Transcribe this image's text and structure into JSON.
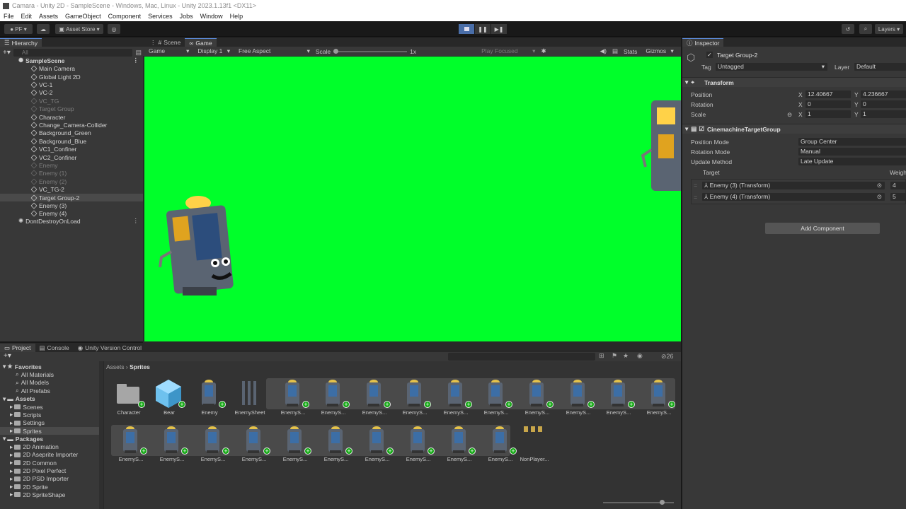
{
  "window": {
    "title": "Camara - Unity 2D - SampleScene - Windows, Mac, Linux - Unity 2023.1.13f1 <DX11>"
  },
  "menu": [
    "File",
    "Edit",
    "Assets",
    "GameObject",
    "Component",
    "Services",
    "Jobs",
    "Window",
    "Help"
  ],
  "toolbar": {
    "account": "PF",
    "asset_store": "Asset Store",
    "layers": "Layers"
  },
  "hierarchy": {
    "tab": "Hierarchy",
    "search_placeholder": "All",
    "scene": "SampleScene",
    "items": [
      {
        "label": "Main Camera",
        "dim": false,
        "sel": false
      },
      {
        "label": "Global Light 2D",
        "dim": false,
        "sel": false
      },
      {
        "label": "VC-1",
        "dim": false,
        "sel": false
      },
      {
        "label": "VC-2",
        "dim": false,
        "sel": false
      },
      {
        "label": "VC_TG",
        "dim": true,
        "sel": false
      },
      {
        "label": "Target Group",
        "dim": true,
        "sel": false
      },
      {
        "label": "Character",
        "dim": false,
        "sel": false
      },
      {
        "label": "Change_Camera-Collider",
        "dim": false,
        "sel": false
      },
      {
        "label": "Background_Green",
        "dim": false,
        "sel": false
      },
      {
        "label": "Background_Blue",
        "dim": false,
        "sel": false
      },
      {
        "label": "VC1_Confiner",
        "dim": false,
        "sel": false
      },
      {
        "label": "VC2_Confiner",
        "dim": false,
        "sel": false
      },
      {
        "label": "Enemy",
        "dim": true,
        "sel": false
      },
      {
        "label": "Enemy (1)",
        "dim": true,
        "sel": false
      },
      {
        "label": "Enemy (2)",
        "dim": true,
        "sel": false
      },
      {
        "label": "VC_TG-2",
        "dim": false,
        "sel": false
      },
      {
        "label": "Target Group-2",
        "dim": false,
        "sel": true
      },
      {
        "label": "Enemy (3)",
        "dim": false,
        "sel": false
      },
      {
        "label": "Enemy (4)",
        "dim": false,
        "sel": false
      }
    ],
    "dont_destroy": "DontDestroyOnLoad"
  },
  "game": {
    "tabs": [
      "Scene",
      "Game"
    ],
    "mode": "Game",
    "display": "Display 1",
    "aspect": "Free Aspect",
    "scale_label": "Scale",
    "scale_value": "1x",
    "play_focused": "Play Focused",
    "stats": "Stats",
    "gizmos": "Gizmos"
  },
  "inspector": {
    "tab": "Inspector",
    "object_name": "Target Group-2",
    "tag_label": "Tag",
    "tag_value": "Untagged",
    "layer_label": "Layer",
    "layer_value": "Default",
    "transform": {
      "title": "Transform",
      "position_label": "Position",
      "pos_x": "12.40667",
      "pos_y": "4.236667",
      "rotation_label": "Rotation",
      "rot_x": "0",
      "rot_y": "0",
      "scale_label": "Scale",
      "scale_x": "1",
      "scale_y": "1"
    },
    "ctg": {
      "title": "CinemachineTargetGroup",
      "position_mode_label": "Position Mode",
      "position_mode": "Group Center",
      "rotation_mode_label": "Rotation Mode",
      "rotation_mode": "Manual",
      "update_method_label": "Update Method",
      "update_method": "Late Update",
      "target_col": "Target",
      "weight_col": "Weigh",
      "targets": [
        {
          "name": "Enemy (3) (Transform)",
          "weight": "4"
        },
        {
          "name": "Enemy (4) (Transform)",
          "weight": "5"
        }
      ]
    },
    "add_component": "Add Component"
  },
  "project": {
    "tabs": [
      "Project",
      "Console",
      "Unity Version Control"
    ],
    "favorites": {
      "title": "Favorites",
      "items": [
        "All Materials",
        "All Models",
        "All Prefabs"
      ]
    },
    "assets": {
      "title": "Assets",
      "items": [
        "Scenes",
        "Scripts",
        "Settings",
        "Sprites"
      ]
    },
    "packages": {
      "title": "Packages",
      "items": [
        "2D Animation",
        "2D Aseprite Importer",
        "2D Common",
        "2D Pixel Perfect",
        "2D PSD Importer",
        "2D Sprite",
        "2D SpriteShape"
      ]
    },
    "breadcrumb_root": "Assets",
    "breadcrumb_current": "Sprites",
    "count": "26",
    "row1": [
      "Character",
      "Bear",
      "Enemy",
      "EnemySheet",
      "EnemyS...",
      "EnemyS...",
      "EnemyS...",
      "EnemyS...",
      "EnemyS...",
      "EnemyS...",
      "EnemyS...",
      "EnemyS...",
      "EnemyS...",
      "EnemyS..."
    ],
    "row2": [
      "EnemyS...",
      "EnemyS...",
      "EnemyS...",
      "EnemyS...",
      "EnemyS...",
      "EnemyS...",
      "EnemyS...",
      "EnemyS...",
      "EnemyS...",
      "EnemyS...",
      "NonPlayer..."
    ]
  }
}
